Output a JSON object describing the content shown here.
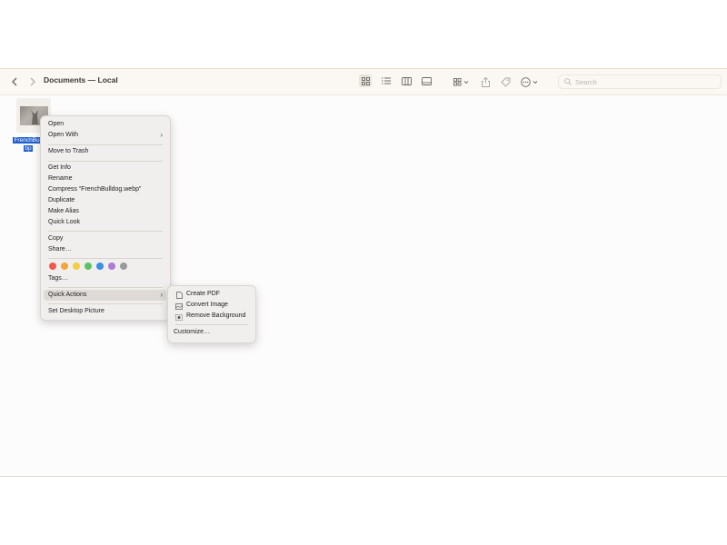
{
  "window": {
    "title": "Documents — Local"
  },
  "toolbar": {
    "back_icon": "chevron-left-icon",
    "forward_icon": "chevron-right-icon",
    "search_placeholder": "Search"
  },
  "file": {
    "label_line1": "FrenchBull",
    "label_line2": "bp"
  },
  "context_menu": {
    "items": {
      "open": "Open",
      "open_with": "Open With",
      "move_to_trash": "Move to Trash",
      "get_info": "Get Info",
      "rename": "Rename",
      "compress": "Compress “FrenchBulldog.webp”",
      "duplicate": "Duplicate",
      "make_alias": "Make Alias",
      "quick_look": "Quick Look",
      "copy": "Copy",
      "share": "Share…",
      "tags": "Tags…",
      "quick_actions": "Quick Actions",
      "set_desktop_picture": "Set Desktop Picture"
    },
    "tag_colors": [
      "#ee5a4f",
      "#f5a43a",
      "#f4cc3d",
      "#5ac263",
      "#3d8ee8",
      "#b07ad6",
      "#9a9a9a"
    ]
  },
  "quick_actions_menu": {
    "create_pdf": "Create PDF",
    "convert_image": "Convert Image",
    "remove_background": "Remove Background",
    "customize": "Customize…"
  }
}
